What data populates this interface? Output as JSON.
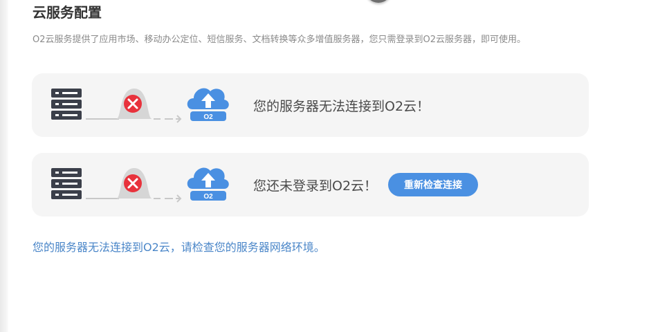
{
  "header": {
    "title": "云服务配置",
    "description": "O2云服务提供了应用市场、移动办公定位、短信服务、文档转换等众多增值服务器，您只需登录到O2云服务器，即可使用。"
  },
  "cards": [
    {
      "message": "您的服务器无法连接到O2云！",
      "icons": [
        "server-icon",
        "error-x-icon",
        "cloud-o2-icon"
      ],
      "cloud_label": "O2"
    },
    {
      "message": "您还未登录到O2云！",
      "button_label": "重新检查连接",
      "icons": [
        "server-icon",
        "error-x-icon",
        "cloud-o2-icon"
      ],
      "cloud_label": "O2"
    }
  ],
  "footer": {
    "hint": "您的服务器无法连接到O2云，请检查您的服务器网络环境。"
  },
  "colors": {
    "accent": "#4a90e2",
    "error": "#e8323c",
    "link": "#4a86c8",
    "card_bg": "#f5f5f5"
  }
}
